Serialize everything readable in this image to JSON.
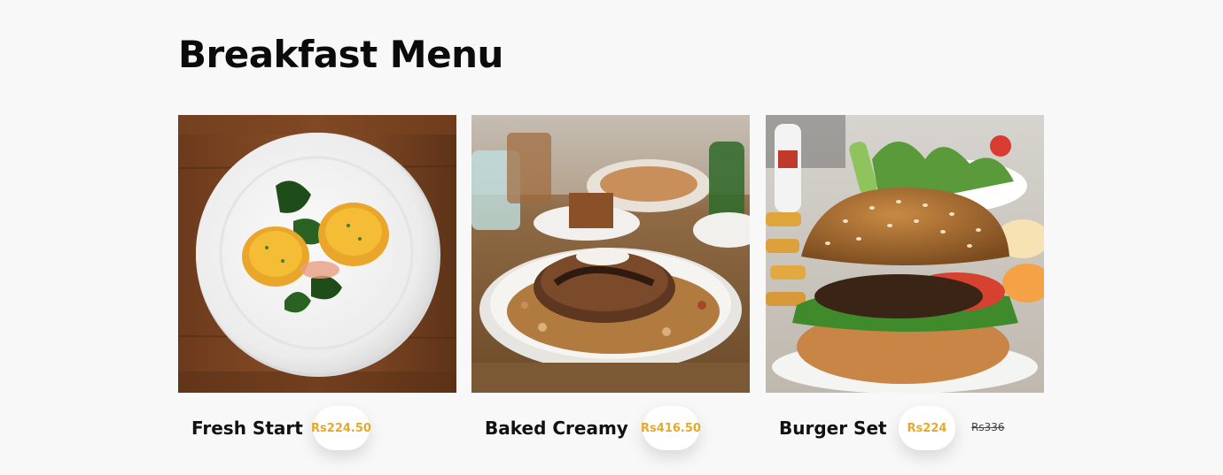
{
  "page": {
    "title": "Breakfast Menu"
  },
  "menu": {
    "items": [
      {
        "name": "Fresh Start",
        "price": "Rs224.50",
        "old_price": "",
        "image": "eggs-benedict-plate-photo"
      },
      {
        "name": "Baked Creamy",
        "price": "Rs416.50",
        "old_price": "",
        "image": "pancakes-granola-plate-photo"
      },
      {
        "name": "Burger Set",
        "price": "Rs224",
        "old_price": "Rs336",
        "image": "sesame-burger-fries-photo"
      }
    ]
  },
  "colors": {
    "background": "#f8f8f8",
    "price_accent": "#e6a92b",
    "title": "#0b0b0b"
  }
}
